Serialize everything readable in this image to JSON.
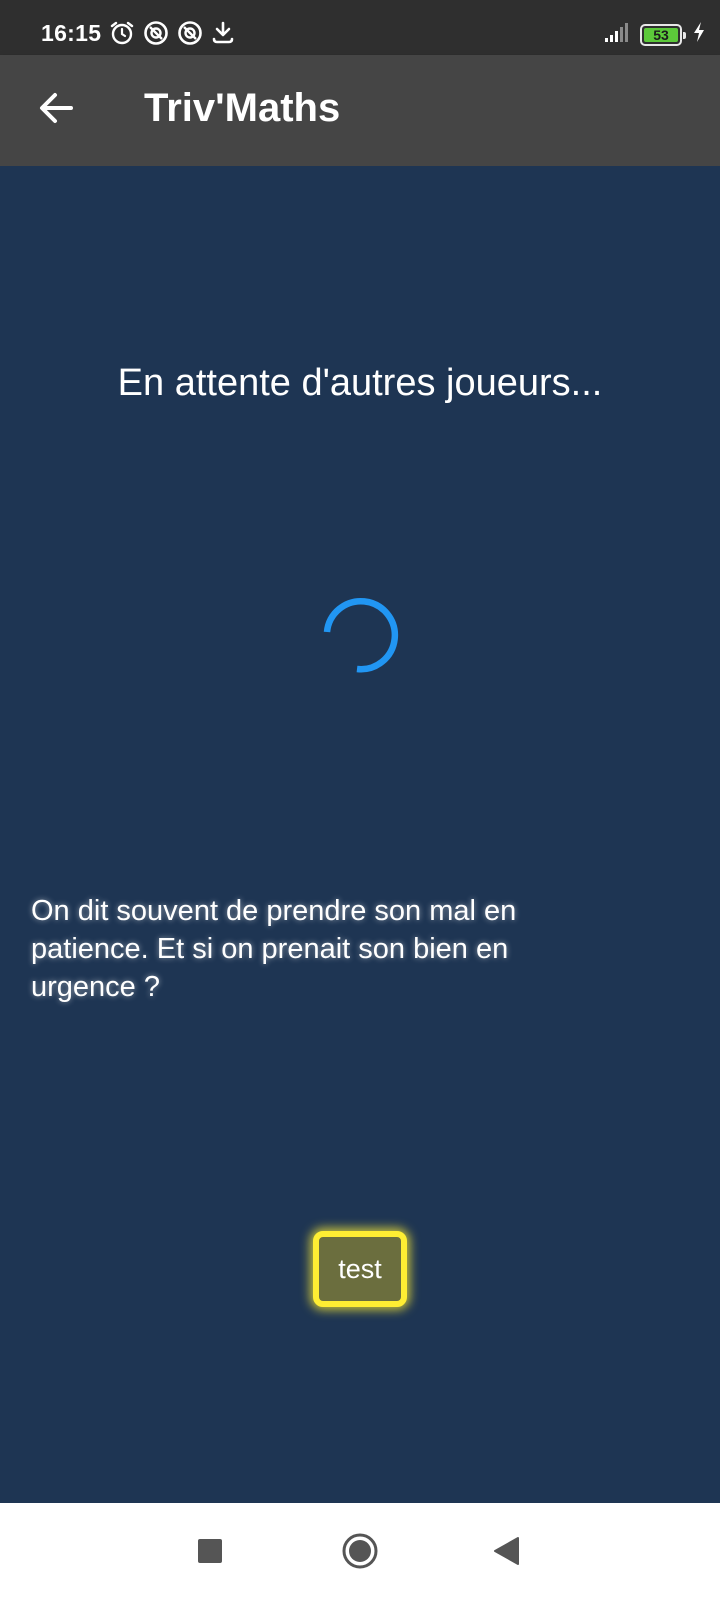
{
  "status_bar": {
    "time": "16:15",
    "left_icons": [
      "alarm-icon",
      "notification-icon",
      "notification-icon",
      "download-icon"
    ],
    "battery_level": "53",
    "battery_color": "#5cc93a",
    "charging": true
  },
  "app_bar": {
    "title": "Triv'Maths",
    "back_icon": "arrow-left-icon",
    "background": "#454545"
  },
  "main": {
    "background": "#1e3553",
    "waiting_text": "En attente d'autres joueurs...",
    "spinner_color": "#2196f3",
    "quote": "On dit souvent de prendre son mal en patience. Et si on prenait son bien en urgence ?",
    "test_button_label": "test",
    "test_button_border": "#ffee33"
  },
  "nav_bar": {
    "buttons": [
      "recents-square-icon",
      "home-circle-icon",
      "back-triangle-icon"
    ]
  }
}
